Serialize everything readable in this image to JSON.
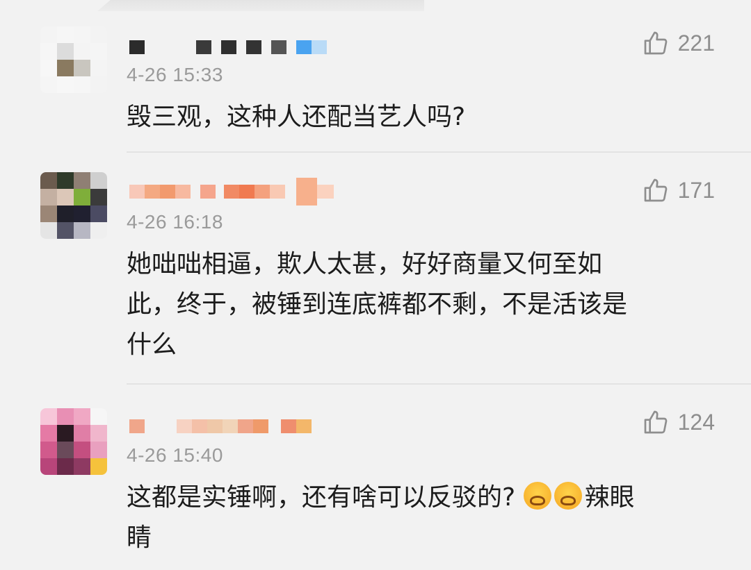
{
  "comments": [
    {
      "time": "4-26 15:33",
      "likes": "221",
      "text": "毁三观，这种人还配当艺人吗?",
      "name_blurred": true
    },
    {
      "time": "4-26 16:18",
      "likes": "171",
      "text_lines": [
        "她咄咄相逼，欺人太甚，好好商量又何至如",
        "此，终于，被锤到连底裤都不剩，不是活该是",
        "什么"
      ],
      "name_blurred": true
    },
    {
      "time": "4-26 15:40",
      "likes": "124",
      "text_part1": "这都是实锤啊，还有啥可以反驳的?",
      "text_emoji_label": "辣眼",
      "text_line2": "睛",
      "emoji_icon": "hot-eyes-emoji",
      "name_blurred": true
    }
  ],
  "icons": {
    "like": "thumbs-up-icon"
  },
  "colors": {
    "background": "#f2f2f2",
    "meta_text": "#9a9a9a",
    "body_text": "#1c1c1c"
  }
}
